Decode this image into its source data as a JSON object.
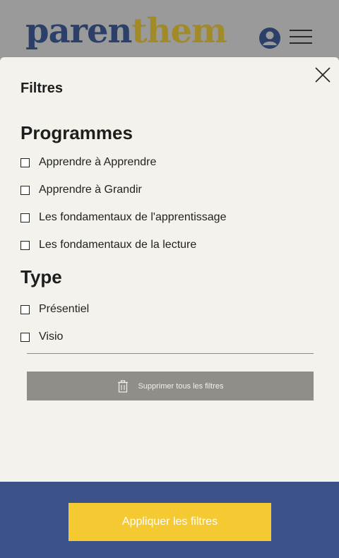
{
  "header": {
    "logo_part1": "paren",
    "logo_part2": "them",
    "avatar_icon": "user-avatar-icon",
    "menu_icon": "hamburger-menu-icon"
  },
  "drawer": {
    "title": "Filtres",
    "close_icon": "close-icon",
    "sections": [
      {
        "title": "Programmes",
        "options": [
          {
            "label": "Apprendre à Apprendre",
            "checked": false
          },
          {
            "label": "Apprendre à Grandir",
            "checked": false
          },
          {
            "label": "Les fondamentaux de l'apprentissage",
            "checked": false
          },
          {
            "label": "Les fondamentaux de la lecture",
            "checked": false
          }
        ]
      },
      {
        "title": "Type",
        "options": [
          {
            "label": "Présentiel",
            "checked": false
          },
          {
            "label": "Visio",
            "checked": false
          }
        ]
      }
    ],
    "clear_button": {
      "label": "Supprimer tous les filtres",
      "icon": "trash-icon"
    }
  },
  "footer": {
    "apply_label": "Appliquer les filtres"
  },
  "colors": {
    "logo_blue": "#2b3f69",
    "logo_gold": "#a08a2a",
    "drawer_bg": "#f3f2ec",
    "footer_bg": "#3b5389",
    "apply_bg": "#f5c932",
    "clear_bg": "#8f8e89"
  }
}
